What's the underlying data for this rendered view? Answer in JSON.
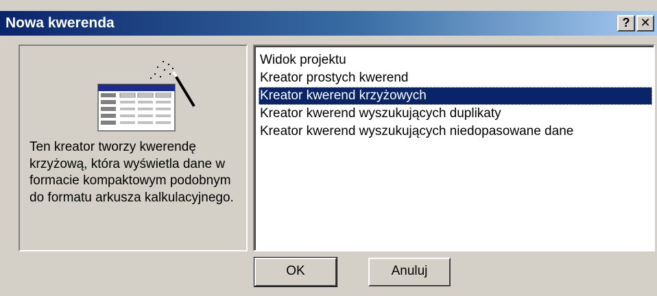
{
  "window": {
    "title": "Nowa kwerenda",
    "help_label": "?",
    "close_label": "✕"
  },
  "description": "Ten kreator tworzy kwerendę krzyżową, która wyświetla dane w formacie kompaktowym podobnym do formatu arkusza kalkulacyjnego.",
  "list": {
    "items": [
      "Widok projektu",
      "Kreator prostych kwerend",
      "Kreator kwerend krzyżowych",
      "Kreator kwerend wyszukujących duplikaty",
      "Kreator kwerend wyszukujących niedopasowane dane"
    ],
    "selected": "Kreator kwerend krzyżowych"
  },
  "buttons": {
    "ok_label": "OK",
    "cancel_label": "Anuluj"
  },
  "colors": {
    "title_gradient_start": "#0a246a",
    "title_gradient_end": "#a6caf0",
    "selection": "#0a246a",
    "face": "#d4d0c8"
  },
  "icons": {
    "wizard": "crosstab-wizard-icon"
  }
}
